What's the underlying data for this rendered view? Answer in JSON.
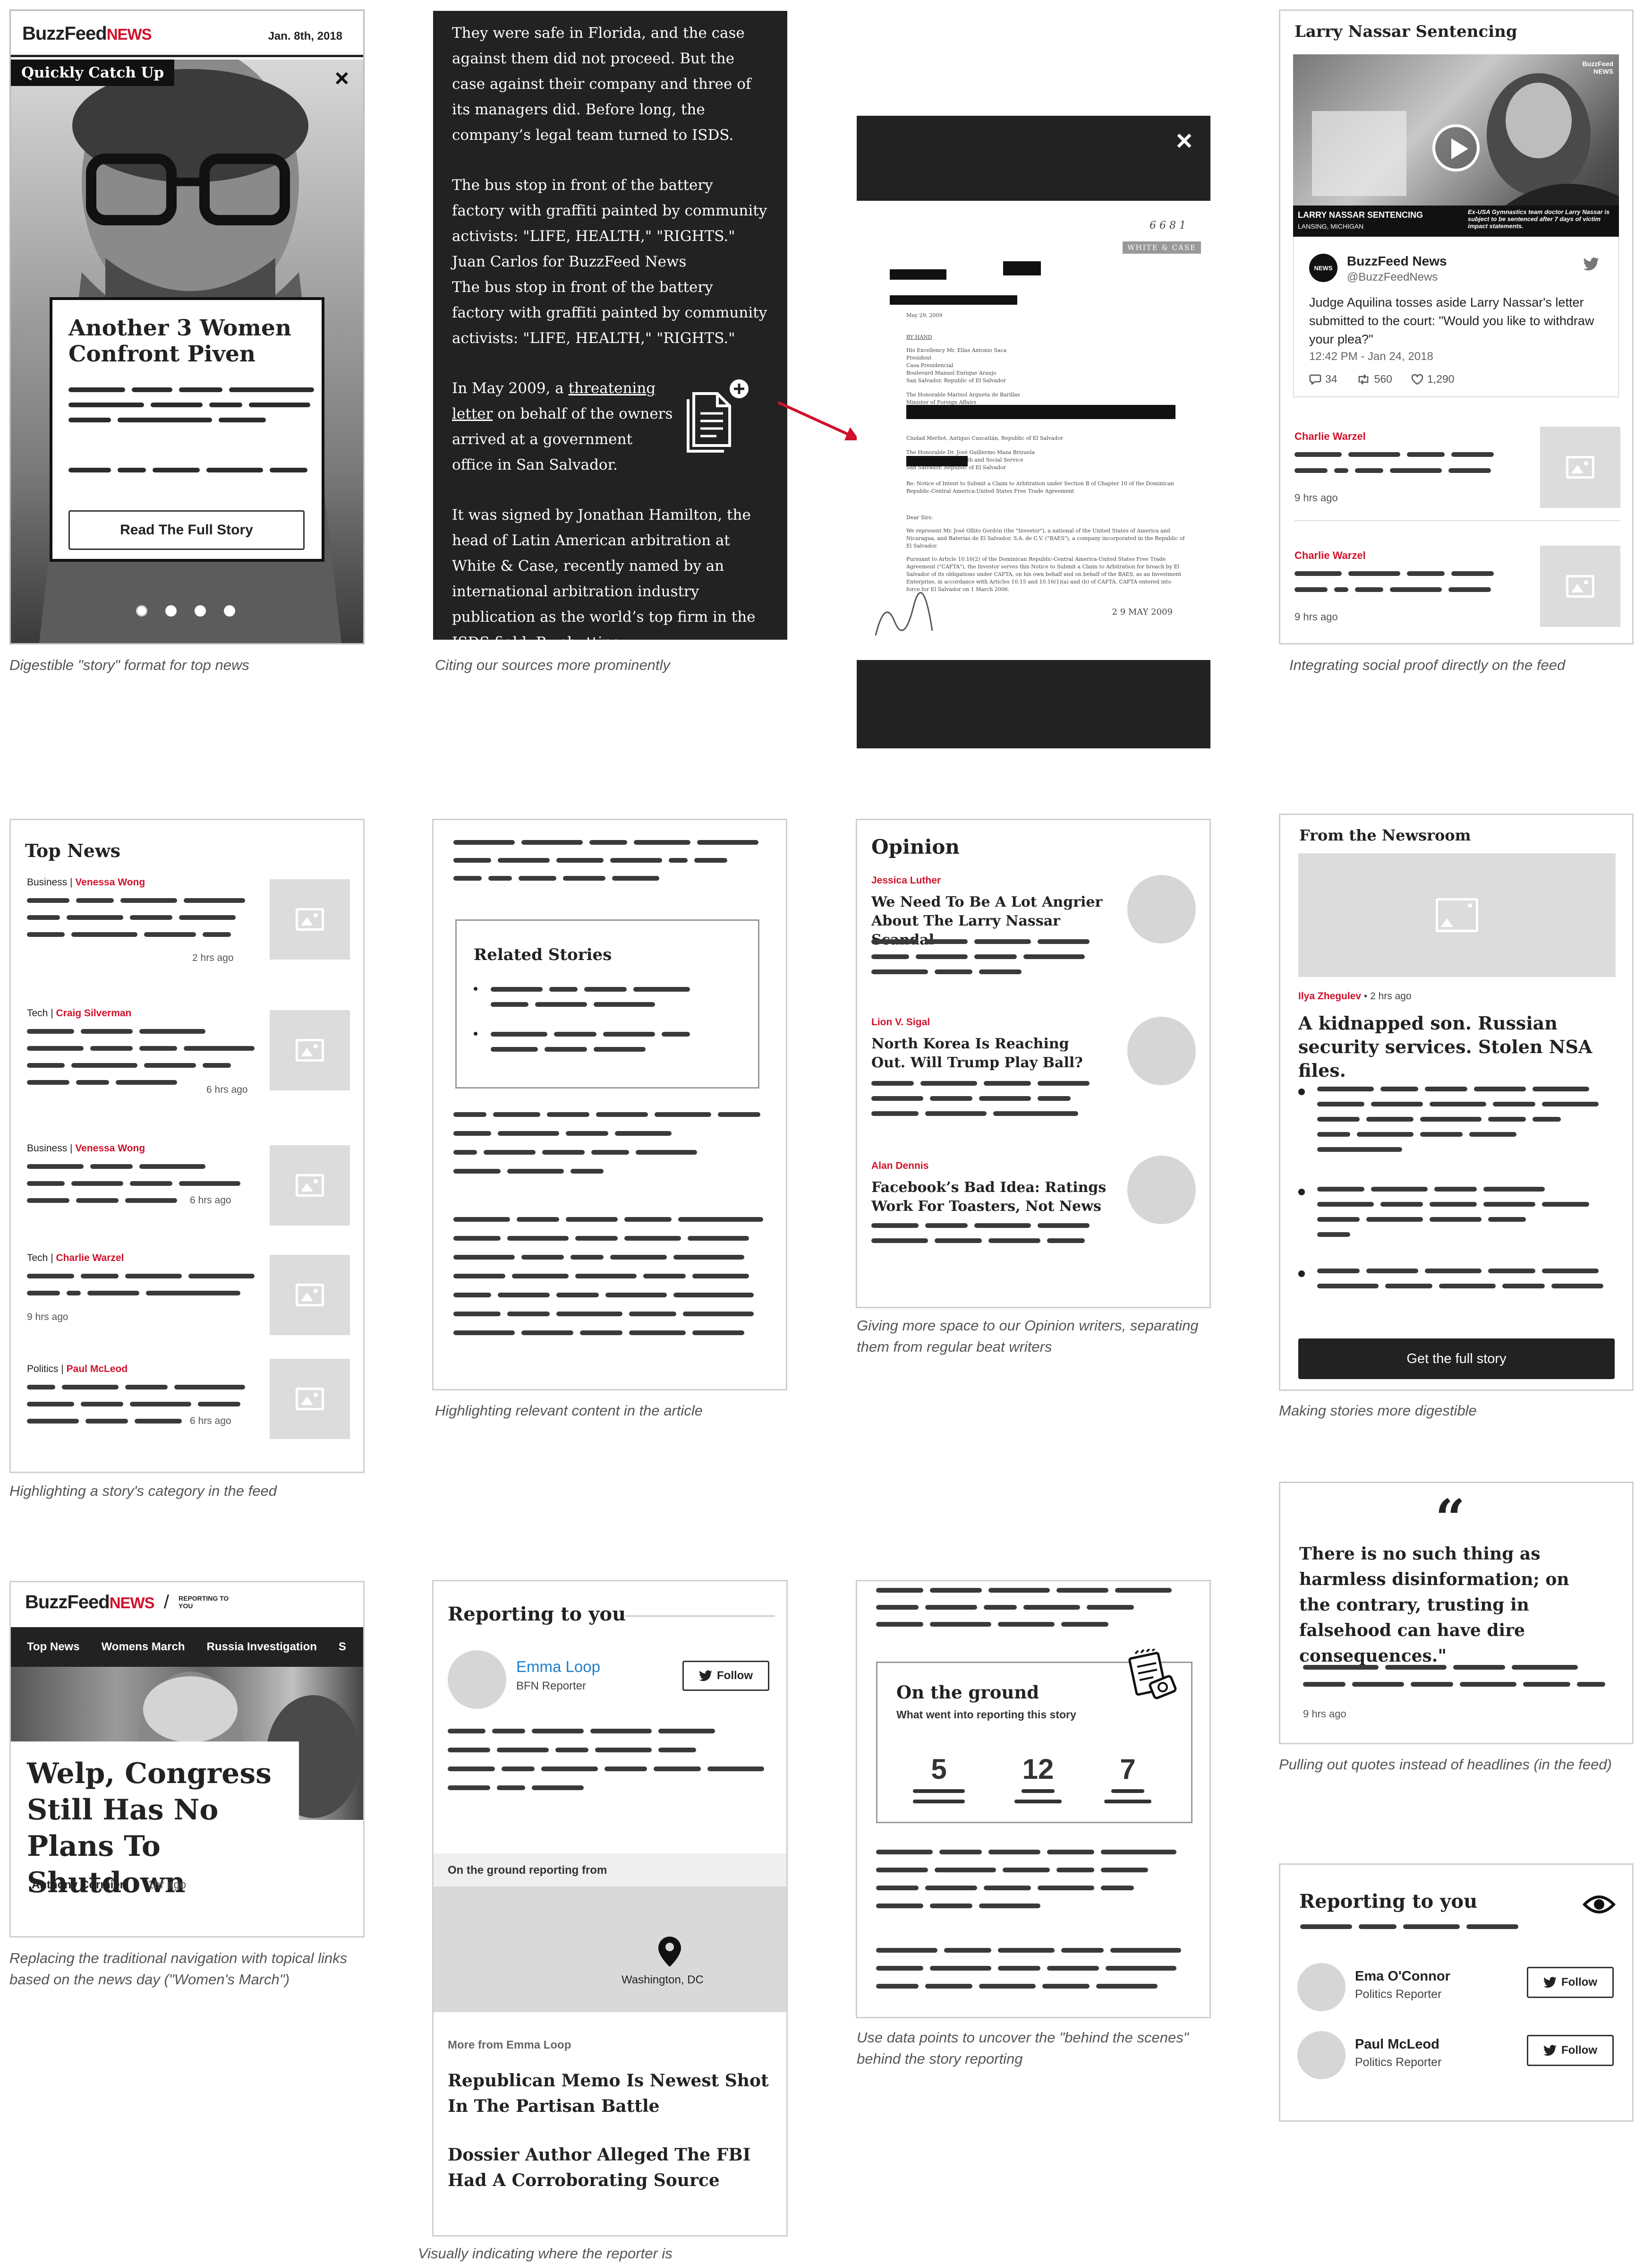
{
  "panel1": {
    "logo_a": "BuzzFeed",
    "logo_b": "NEWS",
    "date": "Jan. 8th, 2018",
    "tag": "Quickly Catch Up",
    "close": "×",
    "headline": "Another 3 Women Confront Piven",
    "button": "Read The Full Story",
    "caption": "Digestible \"story\" format for top news"
  },
  "panel2": {
    "para1": "They were safe in Florida, and the case against them did not proceed. But the case against their company and three of its managers did. Before long, the company’s legal team turned to ISDS.",
    "para2": "The bus stop in front of the battery factory with graffiti painted by community activists: \"LIFE, HEALTH,\" \"RIGHTS.\"",
    "para2b": "Juan Carlos for BuzzFeed News",
    "para2c": "The bus stop in front of the battery factory with graffiti painted by community activists: \"LIFE, HEALTH,\" \"RIGHTS.\"",
    "para3_a": "In May 2009, a ",
    "para3_link1": "threatening",
    "para3_link2": "letter",
    "para3_b": " on behalf of the owners arrived at a government office in San Salvador.",
    "para4": "It was signed by Jonathan Hamilton, the head of Latin American arbitration at White & Case, recently named by an international arbitration industry publication as the world’s top firm in the ISDS field. By shutting",
    "caption": "Citing our sources more prominently"
  },
  "panel3": {
    "close": "×",
    "doc_number": "6 6 8 1",
    "doc_stamp": "WHITE & CASE",
    "doc_lines": [
      "May 29, 2009",
      "BY HAND",
      "His Excellency Mr. Elías Antonio Saca",
      "President",
      "Casa Presidencial",
      "Boulevard Manuel Enrique Araujo",
      "San Salvador, Republic of El Salvador",
      "The Honorable Marisol Argueta de Barillas",
      "Minister of Foreign Affairs",
      "Ciudad Merliot, Antiguo Cuscatlán, Republic of El Salvador",
      "The Honorable Dr. José Guillermo Maza Brizuela",
      "Minister of Public Health and Social Service",
      "San Salvador, Republic of El Salvador",
      "Re: Notice of Intent to Submit a Claim to Arbitration under Section B of Chapter 10 of the Dominican Republic-Central America-United States Free Trade Agreement",
      "Dear Sirs:",
      "We represent Mr. José Ollito Gordón (the \"Investor\"), a national of the United States of America and Nicaragua, and Baterías de El Salvador, S.A. de C.V. (\"BAES\"), a company incorporated in the Republic of El Salvador.",
      "Pursuant to Article 10.16(2) of the Dominican Republic-Central America-United States Free Trade Agreement (\"CAFTA\"), the Investor serves this Notice to Submit a Claim to Arbitration for breach by El Salvador of its obligations under CAFTA, on his own behalf and on behalf of the BAES, as an Investment Enterprise, in accordance with Articles 10.15 and 10.16(1)(a) and (b) of CAFTA. CAFTA entered into force for El Salvador on 1 March 2006."
    ],
    "doc_date_stamp": "2 9 MAY 2009"
  },
  "panel4": {
    "title": "Larry Nassar Sentencing",
    "video_badge": "BuzzFeed NEWS",
    "lower_third_title": "LARRY NASSAR SENTENCING",
    "lower_third_sub": "LANSING, MICHIGAN",
    "lower_third_right": "Ex-USA Gymnastics team doctor Larry Nassar is subject to be sentenced after 7 days of victim impact statements.",
    "tweet_name": "BuzzFeed News",
    "tweet_handle": "@BuzzFeedNews",
    "tweet_avatar": "NEWS",
    "tweet_text": "Judge Aquilina tosses aside Larry Nassar's letter submitted to the court: \"Would you like to withdraw your plea?\"",
    "tweet_time": "12:42 PM - Jan 24, 2018",
    "replies": "34",
    "retweets": "560",
    "likes": "1,290",
    "items": [
      {
        "author": "Charlie Warzel",
        "time": "9 hrs ago"
      },
      {
        "author": "Charlie Warzel",
        "time": "9 hrs ago"
      }
    ],
    "caption": "Integrating social proof directly on the feed"
  },
  "panel5": {
    "title": "Top News",
    "items": [
      {
        "category": "Business",
        "author": "Venessa Wong",
        "time": "2 hrs ago"
      },
      {
        "category": "Tech",
        "author": "Craig Silverman",
        "time": "6 hrs ago"
      },
      {
        "category": "Business",
        "author": "Venessa Wong",
        "time": "6 hrs ago"
      },
      {
        "category": "Tech",
        "author": "Charlie Warzel",
        "time": "9 hrs ago"
      },
      {
        "category": "Politics",
        "author": "Paul McLeod",
        "time": "6 hrs ago"
      }
    ],
    "caption": "Highlighting a story's category in the feed"
  },
  "panel6": {
    "box_title": "Related Stories",
    "caption": "Highlighting relevant content in the article"
  },
  "panel7": {
    "title": "Opinion",
    "items": [
      {
        "author": "Jessica Luther",
        "headline": "We Need To Be A Lot Angrier About The Larry Nassar Scandal"
      },
      {
        "author": "Lion V. Sigal",
        "headline": "North Korea Is Reaching Out. Will Trump Play Ball?"
      },
      {
        "author": "Alan Dennis",
        "headline": "Facebook’s Bad Idea: Ratings Work For Toasters, Not News"
      }
    ],
    "caption": "Giving more space to our Opinion writers, separating them from regular beat writers"
  },
  "panel8": {
    "title": "From the Newsroom",
    "author": "Ilya Zhegulev",
    "time": "• 2 hrs ago",
    "headline": "A kidnapped son. Russian security services. Stolen NSA files.",
    "button": "Get the full story",
    "caption": "Making stories more digestible"
  },
  "panel9": {
    "logo_a": "BuzzFeed",
    "logo_b": "NEWS",
    "logo_sep": "/",
    "section": "REPORTING TO YOU",
    "nav": [
      "Top News",
      "Womens March",
      "Russia Investigation",
      "S"
    ],
    "headline": "Welp, Congress Still Has No Plans To Shutdown",
    "author": "Anthony Cormier",
    "time": "1hr ago",
    "caption": "Replacing the traditional navigation with topical links based on the news day (\"Women's March\")"
  },
  "panel10": {
    "title": "Reporting to you",
    "reporter_name": "Emma Loop",
    "reporter_role": "BFN Reporter",
    "follow": "Follow",
    "ground_label": "On the ground reporting from",
    "location": "Washington, DC",
    "more_label": "More from Emma Loop",
    "more": [
      "Republican Memo Is Newest Shot In The Partisan Battle",
      "Dossier Author Alleged The FBI Had A Corroborating Source"
    ],
    "caption": "Visually indicating where the reporter is"
  },
  "panel11": {
    "box_title": "On the ground",
    "box_sub": "What went into reporting this story",
    "stats": [
      "5",
      "12",
      "7"
    ],
    "caption": "Use data points to uncover the \"behind the scenes\" behind the story reporting"
  },
  "panel12": {
    "quote": "There is no such thing as harmless disinformation; on the contrary, trusting in falsehood can have dire consequences.\"",
    "time": "9 hrs ago",
    "caption": "Pulling out quotes instead of headlines (in the feed)"
  },
  "panel13": {
    "title": "Reporting to you",
    "reporters": [
      {
        "name": "Ema O'Connor",
        "role": "Politics Reporter"
      },
      {
        "name": "Paul McLeod",
        "role": "Politics Reporter"
      }
    ],
    "follow": "Follow"
  }
}
